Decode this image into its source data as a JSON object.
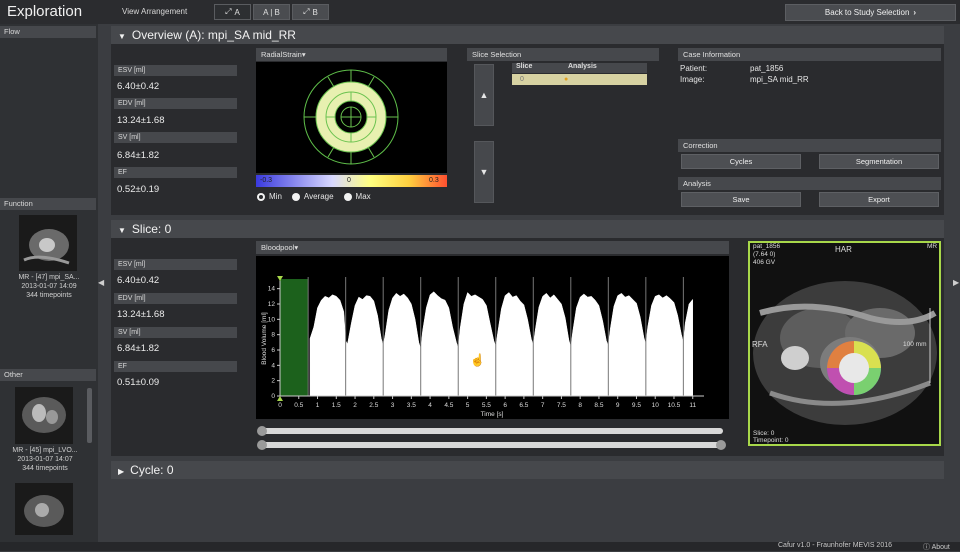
{
  "app": {
    "title": "Exploration",
    "footer": "Cafur v1.0 - Fraunhofer MEVIS 2016",
    "about": "About"
  },
  "view_arrangement": {
    "label": "View Arrangement",
    "options": [
      "A",
      "A | B",
      "B"
    ],
    "selected": "A"
  },
  "back_button": "Back to Study Selection",
  "left_panels": {
    "flow": {
      "title": "Flow"
    },
    "function": {
      "title": "Function",
      "item": {
        "name": "MR - [47] mpi_SA...",
        "date": "2013-01-07 14:09",
        "timepoints": "344 timepoints"
      }
    },
    "other": {
      "title": "Other",
      "item": {
        "name": "MR - [45] mpi_LVO...",
        "date": "2013-01-07 14:07",
        "timepoints": "344 timepoints"
      }
    }
  },
  "overview": {
    "title": "Overview (A): mpi_SA mid_RR",
    "stats": [
      {
        "label": "ESV [ml]",
        "value": "6.40±0.42"
      },
      {
        "label": "EDV [ml]",
        "value": "13.24±1.68"
      },
      {
        "label": "SV [ml]",
        "value": "6.84±1.82"
      },
      {
        "label": "EF",
        "value": "0.52±0.19"
      }
    ],
    "strain": {
      "dropdown": "RadialStrain",
      "scale": {
        "min": "-0.3",
        "mid": "0",
        "max": "0.3"
      },
      "radios": [
        "Min",
        "Average",
        "Max"
      ]
    },
    "slice_selection": {
      "title": "Slice Selection",
      "columns": [
        "Slice",
        "Analysis"
      ],
      "rows": [
        {
          "slice": "0",
          "analysis": "●"
        }
      ]
    },
    "case_info": {
      "title": "Case Information",
      "patient_label": "Patient:",
      "patient": "pat_1856",
      "image_label": "Image:",
      "image": "mpi_SA mid_RR"
    },
    "correction": {
      "title": "Correction",
      "buttons": [
        "Cycles",
        "Segmentation"
      ]
    },
    "analysis": {
      "title": "Analysis",
      "buttons": [
        "Save",
        "Export"
      ]
    }
  },
  "slice": {
    "title": "Slice: 0",
    "stats": [
      {
        "label": "ESV [ml]",
        "value": "6.40±0.42"
      },
      {
        "label": "EDV [ml]",
        "value": "13.24±1.68"
      },
      {
        "label": "SV [ml]",
        "value": "6.84±1.82"
      },
      {
        "label": "EF",
        "value": "0.51±0.09"
      }
    ],
    "chart_dropdown": "Bloodpool",
    "mri": {
      "patient": "pat_1856",
      "line2": "(7.64 0)",
      "line3": "406 GV",
      "top": "HAR",
      "corner": "MR",
      "left": "RFA",
      "scale": "100 mm",
      "slice": "Slice: 0",
      "timepoint": "Timepoint: 0"
    }
  },
  "cycle": {
    "title": "Cycle: 0"
  },
  "chart_data": {
    "type": "area",
    "xlabel": "Time [s]",
    "ylabel": "Blood Volume [ml]",
    "xlim": [
      0,
      11.3
    ],
    "ylim": [
      0,
      15
    ],
    "xticks": [
      0,
      0.5,
      1,
      1.5,
      2,
      2.5,
      3,
      3.5,
      4,
      4.5,
      5,
      5.5,
      6,
      6.5,
      7,
      7.5,
      8,
      8.5,
      9,
      9.5,
      10,
      10.5,
      11
    ],
    "yticks": [
      0,
      2,
      4,
      6,
      8,
      10,
      12,
      14
    ],
    "highlight_range": [
      0,
      0.75
    ],
    "beat_markers": [
      0.75,
      1.75,
      2.75,
      3.75,
      4.75,
      5.75,
      6.75,
      7.75,
      8.75,
      9.75,
      10.75
    ],
    "x": [
      0.8,
      0.9,
      1.0,
      1.1,
      1.2,
      1.3,
      1.4,
      1.5,
      1.6,
      1.7,
      1.75,
      1.8,
      1.9,
      2.0,
      2.1,
      2.2,
      2.3,
      2.4,
      2.5,
      2.6,
      2.7,
      2.75,
      2.8,
      2.9,
      3.0,
      3.1,
      3.2,
      3.3,
      3.4,
      3.5,
      3.6,
      3.7,
      3.75,
      3.8,
      3.9,
      4.0,
      4.1,
      4.2,
      4.3,
      4.4,
      4.5,
      4.6,
      4.7,
      4.75,
      4.8,
      4.9,
      5.0,
      5.1,
      5.2,
      5.3,
      5.4,
      5.5,
      5.6,
      5.7,
      5.75,
      5.8,
      5.9,
      6.0,
      6.1,
      6.2,
      6.3,
      6.4,
      6.5,
      6.6,
      6.7,
      6.75,
      6.8,
      6.9,
      7.0,
      7.1,
      7.2,
      7.3,
      7.4,
      7.5,
      7.6,
      7.7,
      7.75,
      7.8,
      7.9,
      8.0,
      8.1,
      8.2,
      8.3,
      8.4,
      8.5,
      8.6,
      8.7,
      8.75,
      8.8,
      8.9,
      9.0,
      9.1,
      9.2,
      9.3,
      9.4,
      9.5,
      9.6,
      9.7,
      9.75,
      9.8,
      9.9,
      10.0,
      10.1,
      10.2,
      10.3,
      10.4,
      10.5,
      10.6,
      10.7,
      10.75,
      10.8,
      10.9,
      11.0
    ],
    "values": [
      7.5,
      9.0,
      11.5,
      12.5,
      13.0,
      12.8,
      13.2,
      13.0,
      12.5,
      11.0,
      7.2,
      6.8,
      9.5,
      11.8,
      12.9,
      12.6,
      13.1,
      13.0,
      12.4,
      10.5,
      7.5,
      6.6,
      8.0,
      11.2,
      12.8,
      13.4,
      13.0,
      13.3,
      12.8,
      12.0,
      10.0,
      7.0,
      6.2,
      8.5,
      11.5,
      13.2,
      13.6,
      13.1,
      12.7,
      12.5,
      11.5,
      9.0,
      7.0,
      6.3,
      8.8,
      12.0,
      13.5,
      13.0,
      13.2,
      12.9,
      12.6,
      11.8,
      9.5,
      7.2,
      6.5,
      8.2,
      11.4,
      13.1,
      13.5,
      12.9,
      13.1,
      12.4,
      11.9,
      10.0,
      7.4,
      6.7,
      8.6,
      11.6,
      13.0,
      13.4,
      12.8,
      13.2,
      12.6,
      12.0,
      10.2,
      7.3,
      6.4,
      8.4,
      11.5,
      12.9,
      13.3,
      12.9,
      13.0,
      12.5,
      11.8,
      9.8,
      7.2,
      6.6,
      8.7,
      11.7,
      13.1,
      13.4,
      12.9,
      13.1,
      12.6,
      12.1,
      10.3,
      7.6,
      6.8,
      9.0,
      11.8,
      13.0,
      13.2,
      12.8,
      13.1,
      12.7,
      12.2,
      10.5,
      8.0,
      7.0,
      9.5,
      12.0,
      12.6
    ]
  },
  "colors": {
    "accent_green": "#a8d84a",
    "highlight_green": "#1f6b1f"
  }
}
